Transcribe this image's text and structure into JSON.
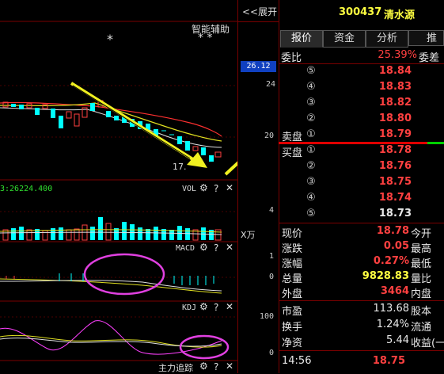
{
  "header": {
    "expand_label": "<<展开",
    "stock_code": "300437",
    "stock_name": "清水源",
    "assist_label": "智能辅助",
    "star_single": "*",
    "star_double": "* *"
  },
  "price_axis": {
    "top_value": "26.12",
    "tick_24": "24",
    "tick_20": "20",
    "vol_tick": "4",
    "vol_unit": "X万",
    "macd_1": "1",
    "macd_0": "0",
    "kdj_100": "100",
    "kdj_0": "0"
  },
  "chart": {
    "low_label": "17.",
    "vol_title": "VOL",
    "vol_value": "3:26224.400",
    "macd_title": "MACD",
    "kdj_title": "KDJ",
    "main_force_title": "主力追踪"
  },
  "icons": {
    "gear": "gear-icon",
    "help": "help-icon",
    "close": "close-icon"
  },
  "tabs": [
    "报价",
    "资金",
    "分析",
    "推"
  ],
  "webi": {
    "label": "委比",
    "value": "25.39%",
    "label2": "委差"
  },
  "sell_orders": [
    {
      "label": "⑤",
      "price": "18.84"
    },
    {
      "label": "④",
      "price": "18.83"
    },
    {
      "label": "③",
      "price": "18.82"
    },
    {
      "label": "②",
      "price": "18.80"
    },
    {
      "label": "①",
      "price": "18.79",
      "prefix": "卖盘"
    }
  ],
  "buy_orders": [
    {
      "label": "①",
      "price": "18.78",
      "prefix": "买盘"
    },
    {
      "label": "②",
      "price": "18.76"
    },
    {
      "label": "③",
      "price": "18.75"
    },
    {
      "label": "④",
      "price": "18.74"
    },
    {
      "label": "⑤",
      "price": "18.73"
    }
  ],
  "stats1": [
    {
      "label": "现价",
      "value": "18.78",
      "label2": "今开"
    },
    {
      "label": "涨跌",
      "value": "0.05",
      "label2": "最高"
    },
    {
      "label": "涨幅",
      "value": "0.27%",
      "label2": "最低"
    },
    {
      "label": "总量",
      "value": "9828.83",
      "label2": "量比"
    },
    {
      "label": "外盘",
      "value": "3464",
      "label2": "内盘"
    }
  ],
  "stats2": [
    {
      "label": "市盈",
      "value": "113.68",
      "label2": "股本"
    },
    {
      "label": "换手",
      "value": "1.24%",
      "label2": "流通"
    },
    {
      "label": "净资",
      "value": "5.44",
      "label2": "收益(一)"
    }
  ],
  "tick": {
    "time": "14:56",
    "price": "18.75"
  },
  "colors": {
    "up": "#ff4040",
    "down": "#00ffff",
    "bg": "#000000",
    "grid": "#7a0000",
    "highlight": "#1040c0"
  }
}
